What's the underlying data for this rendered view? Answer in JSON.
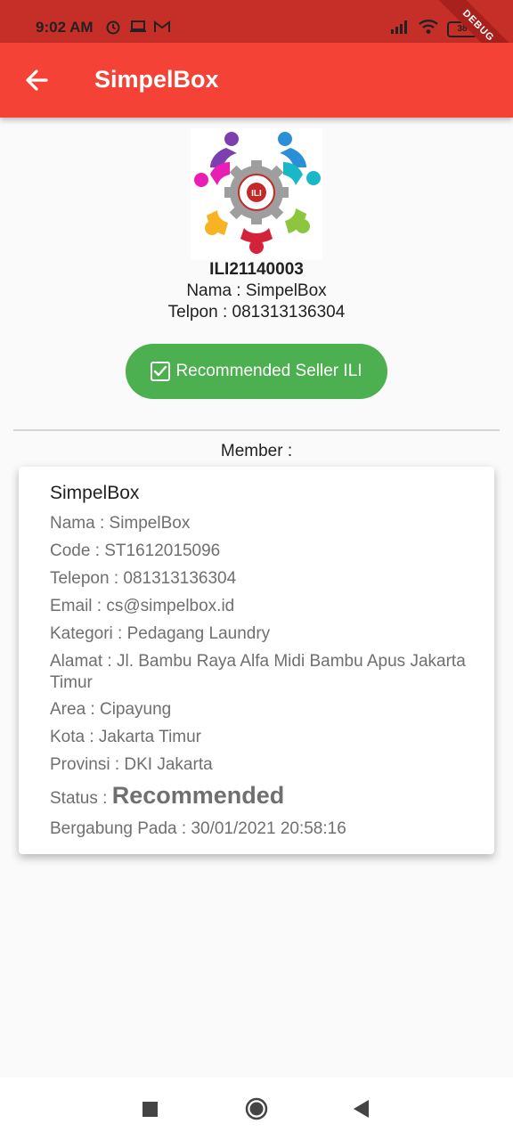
{
  "status_bar": {
    "time": "9:02 AM",
    "battery": "38",
    "debug_banner": "DEBUG"
  },
  "app_bar": {
    "title": "SimpelBox",
    "back_icon": "arrow-left-icon"
  },
  "seller": {
    "logo_text": "ILI",
    "id": "ILI21140003",
    "name_line": "Nama : SimpelBox",
    "phone_line": "Telpon : 081313136304",
    "badge_label": "Recommended Seller ILI"
  },
  "member_label": "Member :",
  "member": {
    "title": "SimpelBox",
    "name": "Nama : SimpelBox",
    "code": "Code : ST1612015096",
    "phone": "Telepon : 081313136304",
    "email": "Email : cs@simpelbox.id",
    "category": "Kategori : Pedagang Laundry",
    "address": "Alamat : Jl. Bambu Raya Alfa Midi Bambu Apus Jakarta Timur",
    "area": "Area : Cipayung",
    "city": "Kota : Jakarta Timur",
    "province": "Provinsi : DKI Jakarta",
    "status_label": "Status : ",
    "status_value": "Recommended",
    "joined": "Bergabung Pada : 30/01/2021 20:58:16"
  },
  "colors": {
    "status_bar": "#c62f28",
    "app_bar": "#f44336",
    "badge": "#4caf50",
    "background": "#fafafa"
  }
}
